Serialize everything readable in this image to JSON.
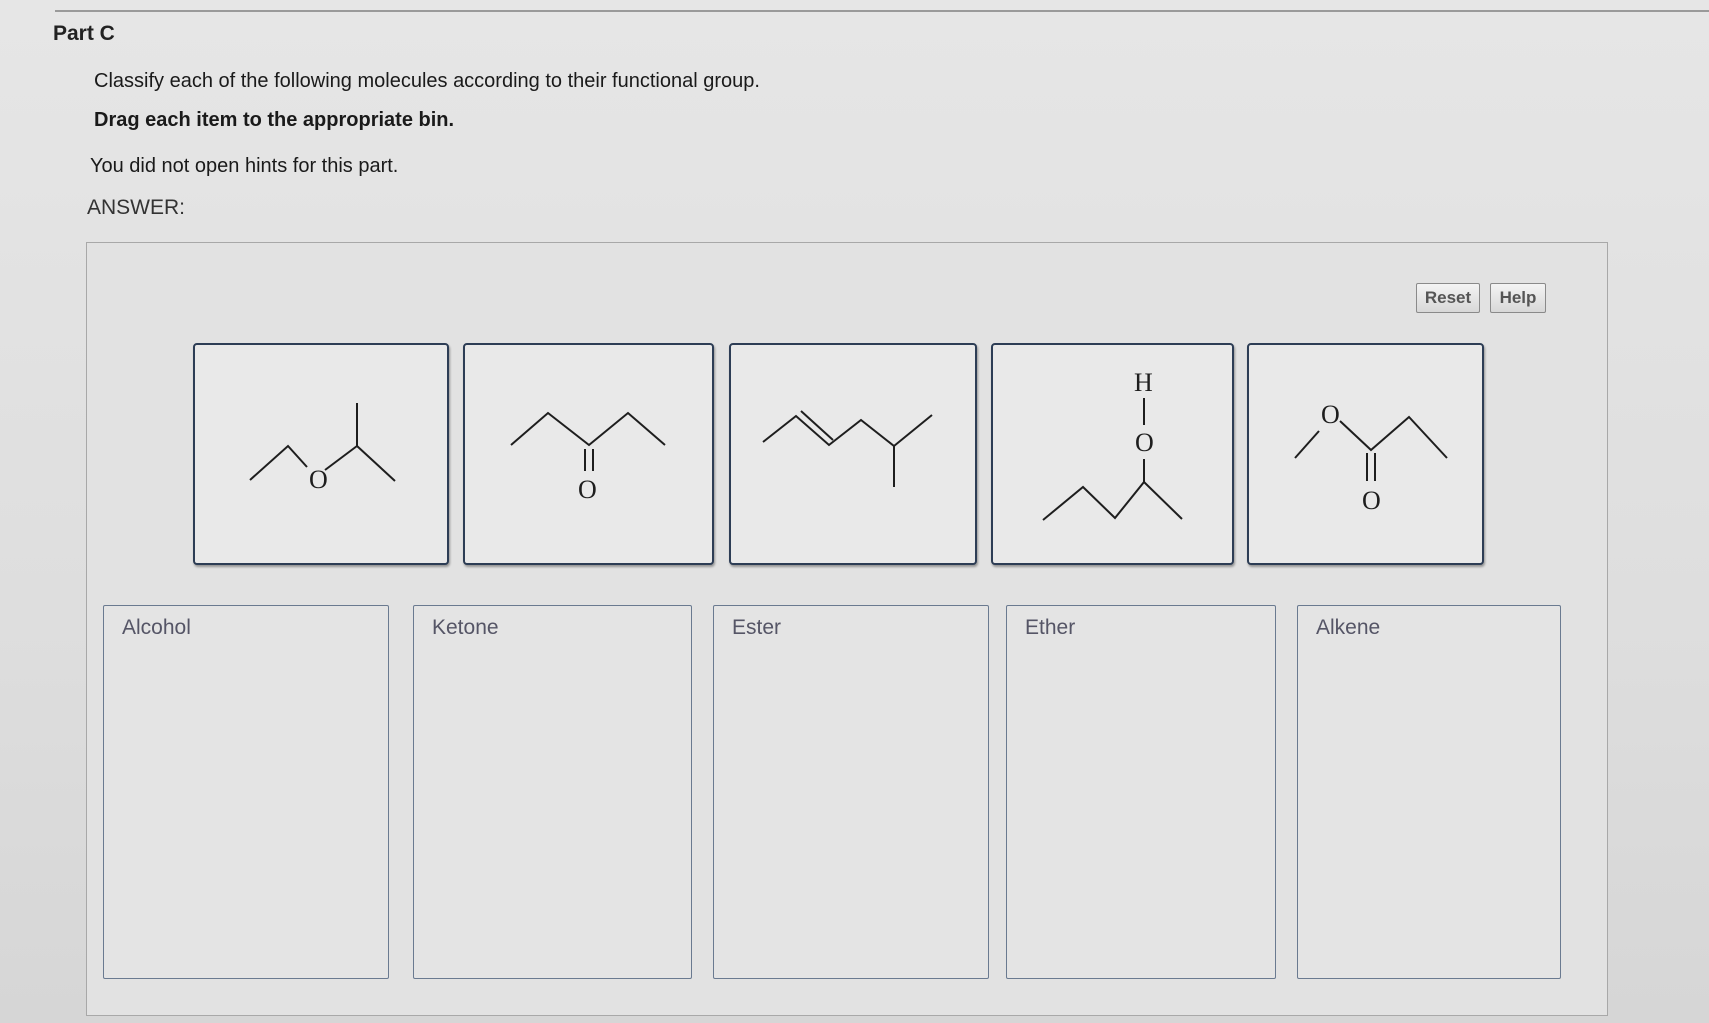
{
  "part": {
    "title": "Part C"
  },
  "instructions": {
    "line1": "Classify each of the following molecules according to their functional group.",
    "line2": "Drag each item to the appropriate bin.",
    "hints": "You did not open hints for this part."
  },
  "answer_label": "ANSWER:",
  "buttons": {
    "reset": "Reset",
    "help": "Help"
  },
  "molecules": [
    {
      "atoms": [
        "O"
      ]
    },
    {
      "atoms": [
        "O"
      ]
    },
    {
      "atoms": []
    },
    {
      "atoms": [
        "H",
        "O"
      ]
    },
    {
      "atoms": [
        "O",
        "O"
      ]
    }
  ],
  "bins": [
    {
      "label": "Alcohol"
    },
    {
      "label": "Ketone"
    },
    {
      "label": "Ester"
    },
    {
      "label": "Ether"
    },
    {
      "label": "Alkene"
    }
  ]
}
